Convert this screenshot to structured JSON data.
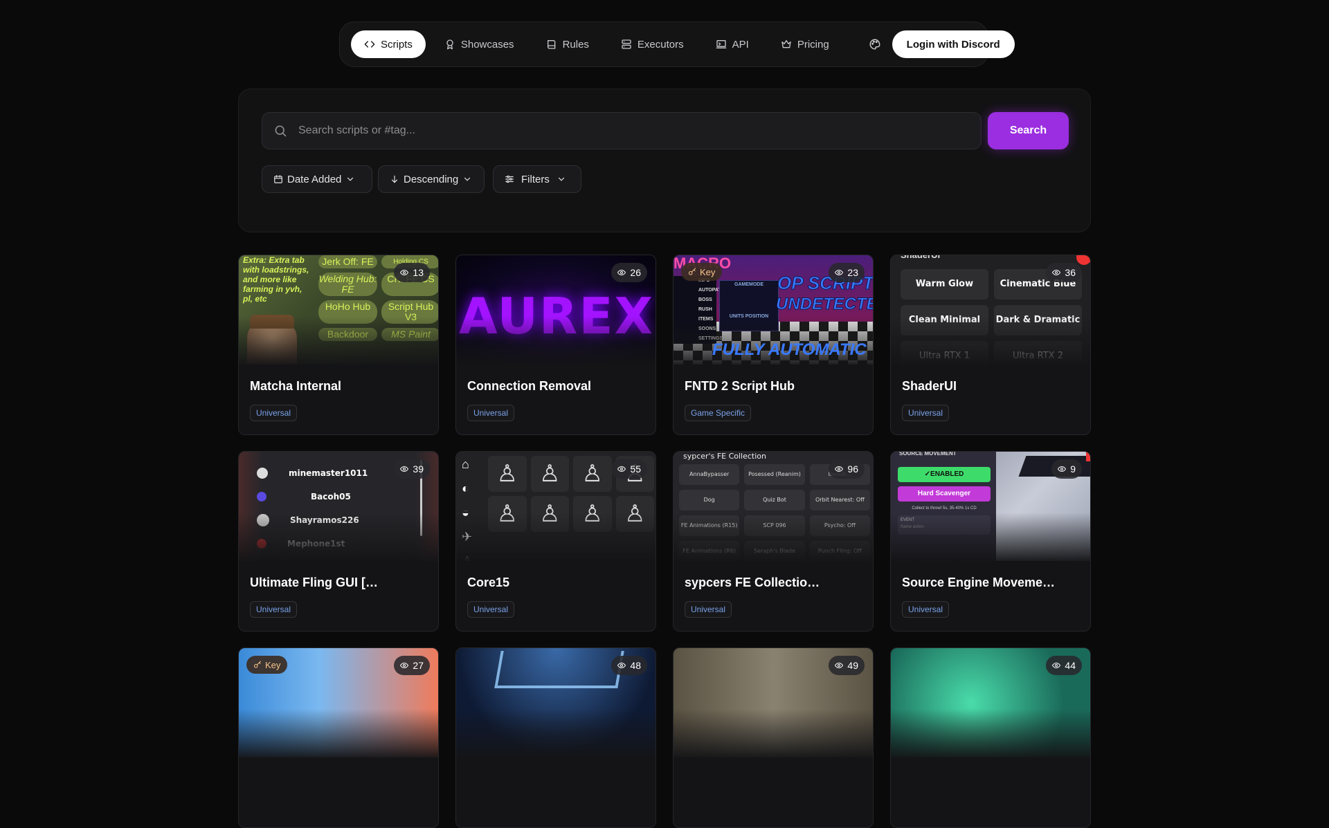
{
  "nav": {
    "items": [
      {
        "label": "Scripts",
        "icon": "code-icon"
      },
      {
        "label": "Showcases",
        "icon": "award-icon"
      },
      {
        "label": "Rules",
        "icon": "book-icon"
      },
      {
        "label": "Executors",
        "icon": "server-icon"
      },
      {
        "label": "API",
        "icon": "terminal-icon"
      },
      {
        "label": "Pricing",
        "icon": "crown-icon"
      }
    ],
    "active": "Scripts",
    "theme_icon": "palette-icon",
    "login_label": "Login with Discord"
  },
  "search": {
    "placeholder": "Search scripts or #tag...",
    "button_label": "Search",
    "sort_field": "Date Added",
    "sort_order": "Descending",
    "filters_label": "Filters",
    "accent_color": "#9b2ee0"
  },
  "cards": [
    {
      "title": "Matcha Internal",
      "tag": "Universal",
      "views": "13",
      "key": false
    },
    {
      "title": "Connection Removal",
      "tag": "Universal",
      "views": "26",
      "key": false
    },
    {
      "title": "FNTD 2 Script Hub",
      "tag": "Game Specific",
      "views": "23",
      "key": true
    },
    {
      "title": "ShaderUI",
      "tag": "Universal",
      "views": "36",
      "key": false
    },
    {
      "title": "Ultimate Fling GUI […",
      "tag": "Universal",
      "views": "39",
      "key": false
    },
    {
      "title": "Core15",
      "tag": "Universal",
      "views": "55",
      "key": false
    },
    {
      "title": "sypcers FE Collectio…",
      "tag": "Universal",
      "views": "96",
      "key": false
    },
    {
      "title": "Source Engine Moveme…",
      "tag": "Universal",
      "views": "9",
      "key": false
    },
    {
      "title": "",
      "tag": "",
      "views": "27",
      "key": true
    },
    {
      "title": "",
      "tag": "",
      "views": "48",
      "key": false
    },
    {
      "title": "",
      "tag": "",
      "views": "49",
      "key": false
    },
    {
      "title": "",
      "tag": "",
      "views": "44",
      "key": false
    }
  ],
  "key_label": "Key",
  "thumbnails": {
    "matcha": {
      "extra_text": "Extra: Extra tab with loadstrings, and more like farming in yvh, pl, etc",
      "buttons": [
        "Jerk Off: FE",
        "Holding CS",
        "Welding Hub: FE",
        "CK: FE CS",
        "HoHo Hub",
        "Script Hub V3",
        "Backdoor",
        "MS Paint"
      ]
    },
    "aurex": {
      "logo": "AUREX"
    },
    "fntd": {
      "top_text": "MACRO",
      "line1": "OP SCRIPT",
      "line2": "UNDETECTED!",
      "line3": "FULLY AUTOMATIC",
      "menu": [
        "INFO",
        "AUTOPATH",
        "BOSS RUSH",
        "ITEMS",
        "SOONS",
        "SETTINGS"
      ],
      "modes": [
        "GAMEMODE",
        "UNITS POSITION"
      ]
    },
    "shader": {
      "header": "ShaderUI",
      "presets": [
        "Warm Glow",
        "Cinematic Blue",
        "Clean Minimal",
        "Dark & Dramatic",
        "Ultra RTX 1",
        "Ultra RTX 2"
      ]
    },
    "fling": {
      "players": [
        "minemaster1011",
        "Bacoh05",
        "Shayramos226",
        "Mephone1st"
      ]
    },
    "sypcers": {
      "header": "sypcer's FE Collection",
      "items": [
        "AnnaBypasser",
        "Posessed (Reanim)",
        "Invisib...",
        "Dog",
        "Quiz Bot",
        "Orbit Nearest: Off",
        "FE Animations (R15)",
        "SCP 096",
        "Psycho: Off",
        "FE Animations (R6)",
        "Seraph's Blade",
        "Punch Fling: Off"
      ]
    },
    "source": {
      "header": "SOURCE MOVEMENT",
      "enabled": "✓ENABLED",
      "scavenger": "Hard Scavenger",
      "note": "Collect to throw! 5s, 35-40% 1s CD",
      "event": "EVENT",
      "event_placeholder": "Name action"
    }
  }
}
